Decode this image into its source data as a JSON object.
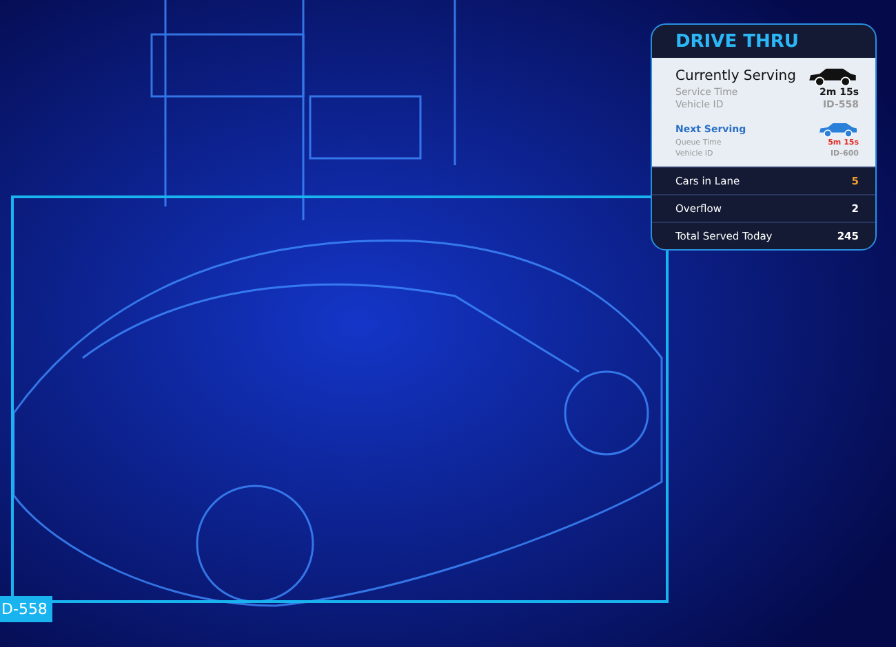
{
  "camera": {
    "detection_label": "D-558"
  },
  "panel": {
    "title": "DRIVE THRU",
    "current": {
      "heading": "Currently Serving",
      "rows": [
        {
          "label": "Service Time",
          "value": "2m 15s",
          "color": "#1a1a1a"
        },
        {
          "label": "Vehicle ID",
          "value": "ID-558",
          "color": "#9a9a9a"
        }
      ]
    },
    "next": {
      "heading": "Next Serving",
      "rows": [
        {
          "label": "Queue Time",
          "value": "5m 15s",
          "color": "#e0302a"
        },
        {
          "label": "Vehicle ID",
          "value": "ID-600",
          "color": "#9a9a9a"
        }
      ]
    },
    "stats": [
      {
        "label": "Cars in Lane",
        "value": "5",
        "color": "#f0a030"
      },
      {
        "label": "Overflow",
        "value": "2",
        "color": "#ffffff"
      },
      {
        "label": "Total Served Today",
        "value": "245",
        "color": "#ffffff"
      }
    ]
  }
}
